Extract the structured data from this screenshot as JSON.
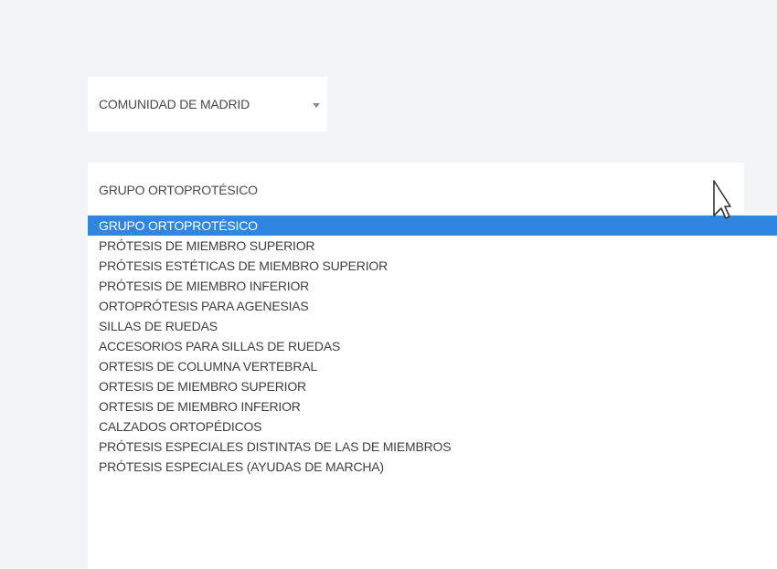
{
  "region_select": {
    "value": "COMUNIDAD DE MADRID"
  },
  "group_select": {
    "value": "GRUPO ORTOPROTÉSICO",
    "options": [
      "GRUPO ORTOPROTÉSICO",
      "PRÓTESIS DE MIEMBRO SUPERIOR",
      "PRÓTESIS ESTÉTICAS DE MIEMBRO SUPERIOR",
      "PRÓTESIS DE MIEMBRO INFERIOR",
      "ORTOPRÓTESIS PARA AGENESIAS",
      "SILLAS DE RUEDAS",
      "ACCESORIOS PARA SILLAS DE RUEDAS",
      "ORTESIS DE COLUMNA VERTEBRAL",
      "ORTESIS DE MIEMBRO SUPERIOR",
      "ORTESIS DE MIEMBRO INFERIOR",
      "CALZADOS ORTOPÉDICOS",
      "PRÓTESIS ESPECIALES DISTINTAS DE LAS DE MIEMBROS",
      "PRÓTESIS ESPECIALES (AYUDAS DE MARCHA)"
    ],
    "highlighted_index": 0
  },
  "colors": {
    "background": "#f3f4f6",
    "highlight": "#2f86e0"
  },
  "icons": {
    "region_caret": "chevron-down-icon",
    "cursor": "mouse-cursor-icon"
  }
}
